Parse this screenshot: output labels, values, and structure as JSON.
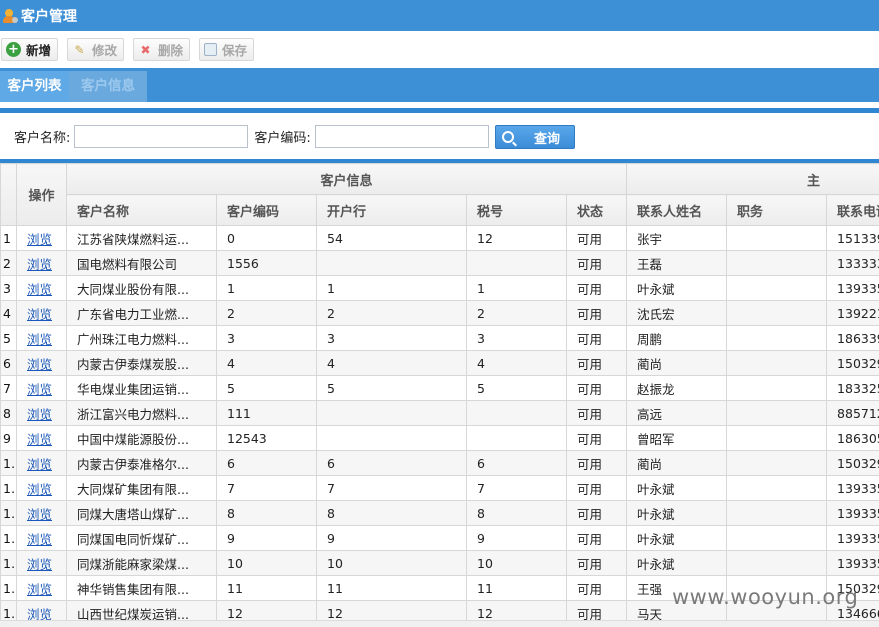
{
  "title": "客户管理",
  "toolbar": {
    "add": "新增",
    "edit": "修改",
    "delete": "删除",
    "save": "保存"
  },
  "tabs": {
    "list": "客户列表",
    "info": "客户信息"
  },
  "search": {
    "name_label": "客户名称:",
    "code_label": "客户编码:",
    "query_label": "查询"
  },
  "grid": {
    "group_headers": {
      "operation": "操作",
      "customer_info": "客户信息",
      "contact_group": "主"
    },
    "columns": {
      "name": "客户名称",
      "code": "客户编码",
      "bank": "开户行",
      "tax": "税号",
      "status": "状态",
      "contact": "联系人姓名",
      "position": "职务",
      "phone": "联系电话"
    },
    "view_label": "浏览",
    "rows": [
      {
        "no": "1",
        "name": "江苏省陕煤燃料运...",
        "code": "0",
        "bank": "54",
        "tax": "12",
        "status": "可用",
        "contact": "张宇",
        "position": "",
        "phone": "151339"
      },
      {
        "no": "2",
        "name": "国电燃料有限公司",
        "code": "1556",
        "bank": "",
        "tax": "",
        "status": "可用",
        "contact": "王磊",
        "position": "",
        "phone": "133333"
      },
      {
        "no": "3",
        "name": "大同煤业股份有限...",
        "code": "1",
        "bank": "1",
        "tax": "1",
        "status": "可用",
        "contact": "叶永斌",
        "position": "",
        "phone": "139335"
      },
      {
        "no": "4",
        "name": "广东省电力工业燃...",
        "code": "2",
        "bank": "2",
        "tax": "2",
        "status": "可用",
        "contact": "沈氏宏",
        "position": "",
        "phone": "139221"
      },
      {
        "no": "5",
        "name": "广州珠江电力燃料...",
        "code": "3",
        "bank": "3",
        "tax": "3",
        "status": "可用",
        "contact": "周鹏",
        "position": "",
        "phone": "186339"
      },
      {
        "no": "6",
        "name": "内蒙古伊泰煤炭股...",
        "code": "4",
        "bank": "4",
        "tax": "4",
        "status": "可用",
        "contact": "蔺尚",
        "position": "",
        "phone": "150329"
      },
      {
        "no": "7",
        "name": "华电煤业集团运销...",
        "code": "5",
        "bank": "5",
        "tax": "5",
        "status": "可用",
        "contact": "赵振龙",
        "position": "",
        "phone": "183325"
      },
      {
        "no": "8",
        "name": "浙江富兴电力燃料...",
        "code": "111",
        "bank": "",
        "tax": "",
        "status": "可用",
        "contact": "高远",
        "position": "",
        "phone": "885712"
      },
      {
        "no": "9",
        "name": "中国中煤能源股份...",
        "code": "12543",
        "bank": "",
        "tax": "",
        "status": "可用",
        "contact": "曾昭军",
        "position": "",
        "phone": "186305"
      },
      {
        "no": "1...",
        "name": "内蒙古伊泰准格尔...",
        "code": "6",
        "bank": "6",
        "tax": "6",
        "status": "可用",
        "contact": "蔺尚",
        "position": "",
        "phone": "150329"
      },
      {
        "no": "1...",
        "name": "大同煤矿集团有限...",
        "code": "7",
        "bank": "7",
        "tax": "7",
        "status": "可用",
        "contact": "叶永斌",
        "position": "",
        "phone": "139335"
      },
      {
        "no": "1...",
        "name": "同煤大唐塔山煤矿...",
        "code": "8",
        "bank": "8",
        "tax": "8",
        "status": "可用",
        "contact": "叶永斌",
        "position": "",
        "phone": "139335"
      },
      {
        "no": "1...",
        "name": "同煤国电同忻煤矿...",
        "code": "9",
        "bank": "9",
        "tax": "9",
        "status": "可用",
        "contact": "叶永斌",
        "position": "",
        "phone": "139335"
      },
      {
        "no": "1...",
        "name": "同煤浙能麻家梁煤...",
        "code": "10",
        "bank": "10",
        "tax": "10",
        "status": "可用",
        "contact": "叶永斌",
        "position": "",
        "phone": "139335"
      },
      {
        "no": "1...",
        "name": "神华销售集团有限...",
        "code": "11",
        "bank": "11",
        "tax": "11",
        "status": "可用",
        "contact": "王强",
        "position": "",
        "phone": "150329"
      },
      {
        "no": "1...",
        "name": "山西世纪煤炭运销...",
        "code": "12",
        "bank": "12",
        "tax": "12",
        "status": "可用",
        "contact": "马天",
        "position": "",
        "phone": "134666"
      }
    ]
  },
  "watermark": "www.wooyun.org"
}
